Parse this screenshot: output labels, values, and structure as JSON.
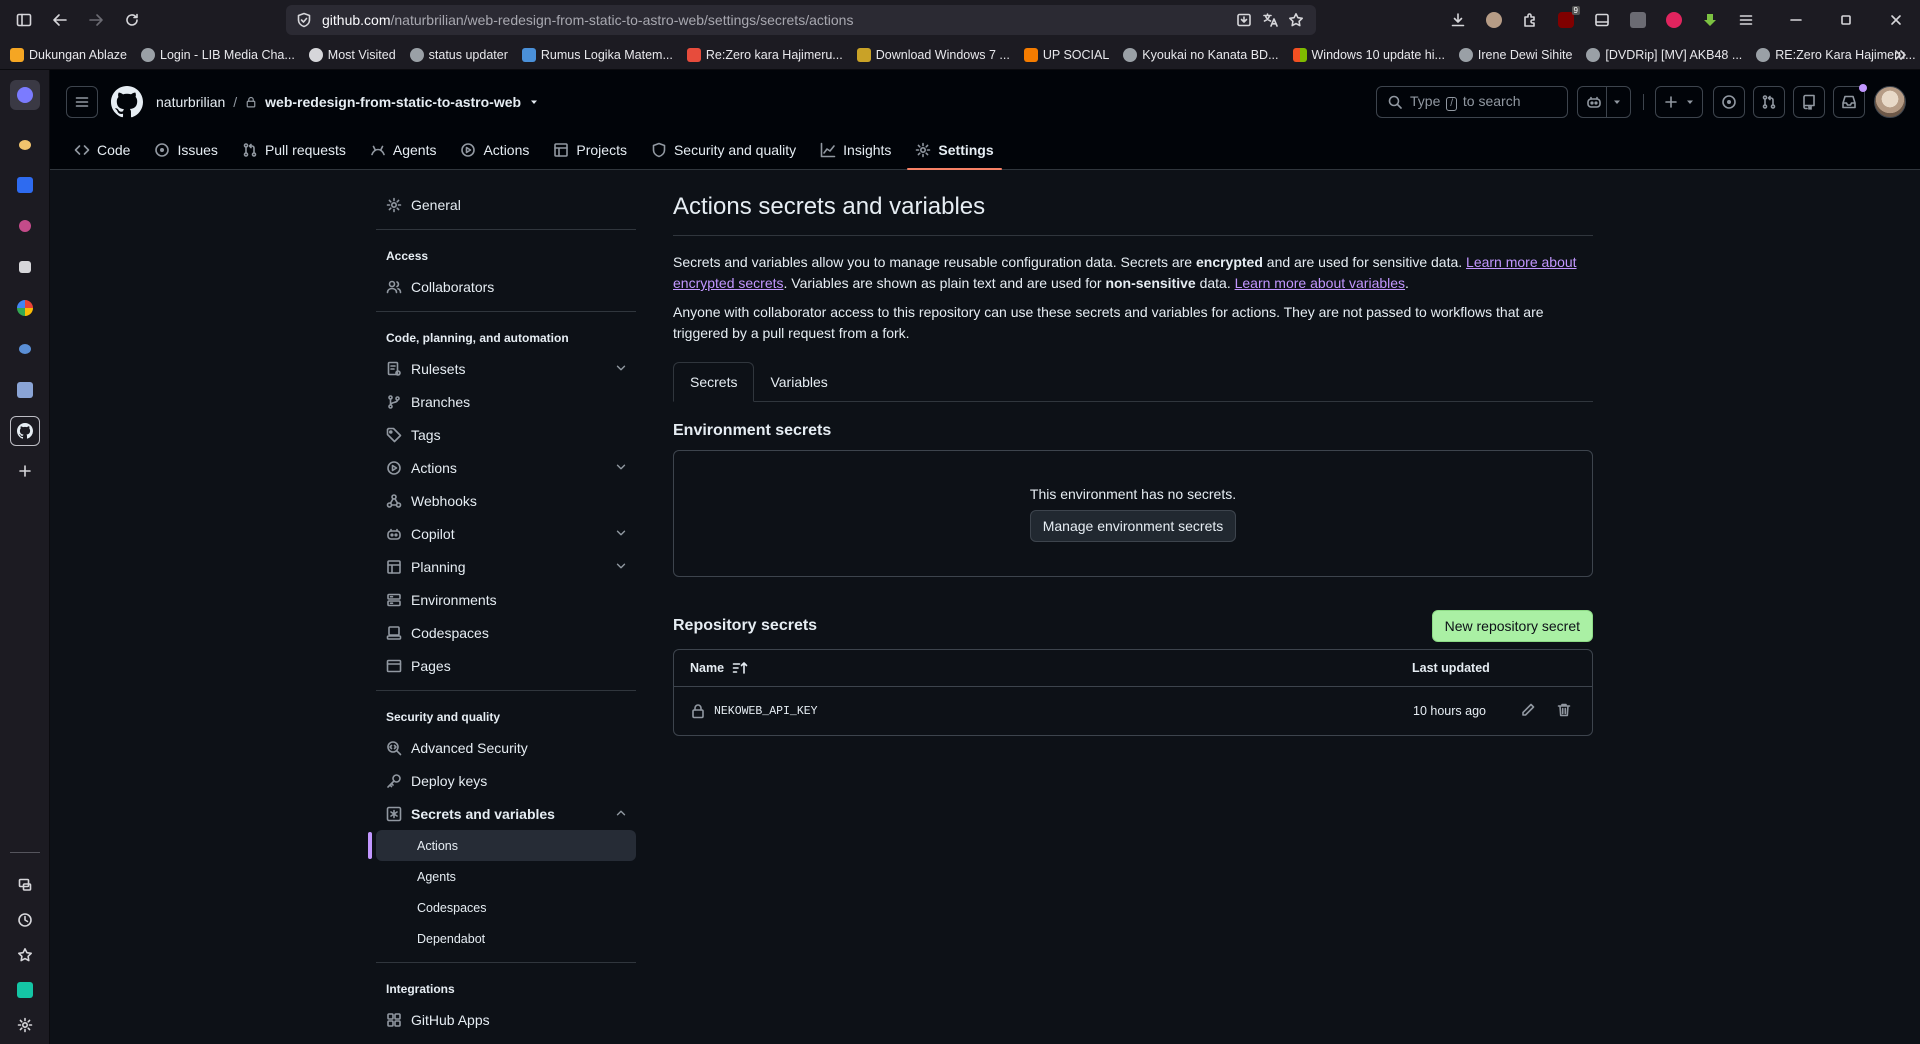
{
  "browser": {
    "url_host": "github.com",
    "url_path": "/naturbrilian/web-redesign-from-static-to-astro-web/settings/secrets/actions",
    "notification_count": "9",
    "bookmarks": [
      {
        "label": "Dukungan Ablaze",
        "color": "#f5a623"
      },
      {
        "label": "Login - LIB Media Cha...",
        "color": "#9aa0a6"
      },
      {
        "label": "Most Visited",
        "color": "#d6d6da"
      },
      {
        "label": "status updater",
        "color": "#9aa0a6"
      },
      {
        "label": "Rumus Logika Matem...",
        "color": "#4a90d9"
      },
      {
        "label": "Re:Zero kara Hajimeru...",
        "color": "#e74c3c"
      },
      {
        "label": "Download Windows 7 ...",
        "color": "#c9a227"
      },
      {
        "label": "UP SOCIAL",
        "color": "#f57c00"
      },
      {
        "label": "Kyoukai no Kanata BD...",
        "color": "#9aa0a6"
      },
      {
        "label": "Windows 10 update hi...",
        "color": "#00a4ef"
      },
      {
        "label": "Irene Dewi Sihite",
        "color": "#9aa0a6"
      },
      {
        "label": "[DVDRip] [MV] AKB48 ...",
        "color": "#9aa0a6"
      },
      {
        "label": "RE:Zero Kara Hajimeru...",
        "color": "#9aa0a6"
      }
    ]
  },
  "header": {
    "owner": "naturbrilian",
    "separator": "/",
    "repo": "web-redesign-from-static-to-astro-web",
    "search_placeholder_pre": "Type",
    "search_key": "/",
    "search_placeholder_post": "to search"
  },
  "repo_nav": [
    {
      "label": "Code",
      "icon": "code-icon",
      "active": false
    },
    {
      "label": "Issues",
      "icon": "issue-icon",
      "active": false
    },
    {
      "label": "Pull requests",
      "icon": "pull-request-icon",
      "active": false
    },
    {
      "label": "Agents",
      "icon": "agents-icon",
      "active": false
    },
    {
      "label": "Actions",
      "icon": "play-icon",
      "active": false
    },
    {
      "label": "Projects",
      "icon": "table-icon",
      "active": false
    },
    {
      "label": "Security and quality",
      "icon": "shield-icon",
      "active": false
    },
    {
      "label": "Insights",
      "icon": "graph-icon",
      "active": false
    },
    {
      "label": "Settings",
      "icon": "gear-icon",
      "active": true
    }
  ],
  "settings_nav": {
    "general": "General",
    "access_group": "Access",
    "collaborators": "Collaborators",
    "code_group": "Code, planning, and automation",
    "rulesets": "Rulesets",
    "branches": "Branches",
    "tags": "Tags",
    "actions": "Actions",
    "webhooks": "Webhooks",
    "copilot": "Copilot",
    "planning": "Planning",
    "environments": "Environments",
    "codespaces": "Codespaces",
    "pages": "Pages",
    "security_group": "Security and quality",
    "advanced_security": "Advanced Security",
    "deploy_keys": "Deploy keys",
    "secrets_and_variables": "Secrets and variables",
    "sub_actions": "Actions",
    "sub_agents": "Agents",
    "sub_codespaces": "Codespaces",
    "sub_dependabot": "Dependabot",
    "integrations_group": "Integrations",
    "github_apps": "GitHub Apps"
  },
  "main": {
    "title": "Actions secrets and variables",
    "p1_a": "Secrets and variables allow you to manage reusable configuration data. Secrets are ",
    "p1_b": "encrypted",
    "p1_c": " and are used for sensitive data. ",
    "p1_link1": "Learn more about encrypted secrets",
    "p1_d": ". Variables are shown as plain text and are used for ",
    "p1_e": "non-sensitive",
    "p1_f": " data. ",
    "p1_link2": "Learn more about variables",
    "p1_g": ".",
    "p2": "Anyone with collaborator access to this repository can use these secrets and variables for actions. They are not passed to workflows that are triggered by a pull request from a fork.",
    "tab_secrets": "Secrets",
    "tab_variables": "Variables",
    "env_title": "Environment secrets",
    "env_empty": "This environment has no secrets.",
    "env_button": "Manage environment secrets",
    "repo_title": "Repository secrets",
    "new_secret_button": "New repository secret",
    "col_name": "Name",
    "col_updated": "Last updated",
    "secrets": [
      {
        "name": "NEKOWEB_API_KEY",
        "updated": "10 hours ago"
      }
    ]
  }
}
